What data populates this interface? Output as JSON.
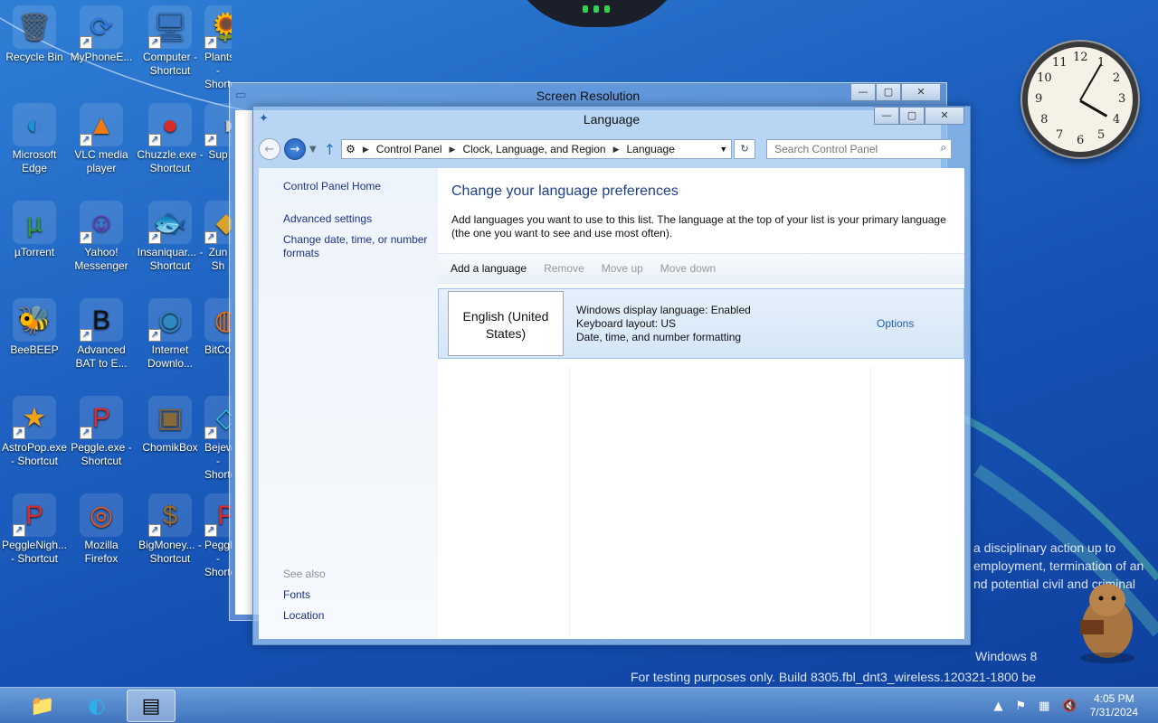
{
  "desktop": {
    "icons": [
      {
        "label": "Recycle Bin",
        "glyph": "🗑"
      },
      {
        "label": "MyPhoneE...",
        "glyph": "⟳"
      },
      {
        "label": "Computer - Shortcut",
        "glyph": "🖥"
      },
      {
        "label": "PlantsVsZo... - Shortcut",
        "glyph": "🌻"
      },
      {
        "label": "Microsoft Edge",
        "glyph": "◐"
      },
      {
        "label": "VLC media player",
        "glyph": "▲"
      },
      {
        "label": "Chuzzle.exe - Shortcut",
        "glyph": "●"
      },
      {
        "label": "Sup",
        "glyph": "◑"
      },
      {
        "label": "µTorrent",
        "glyph": "µ"
      },
      {
        "label": "Yahoo! Messenger",
        "glyph": "☺"
      },
      {
        "label": "Insaniquar... - Shortcut",
        "glyph": "🐟"
      },
      {
        "label": "Zun Sh",
        "glyph": "◆"
      },
      {
        "label": "BeeBEEP",
        "glyph": "🐝"
      },
      {
        "label": "Advanced BAT to E...",
        "glyph": "B"
      },
      {
        "label": "Internet Downlo...",
        "glyph": "◉"
      },
      {
        "label": "BitComet",
        "glyph": "◍"
      },
      {
        "label": "AstroPop.exe - Shortcut",
        "glyph": "★"
      },
      {
        "label": "Peggle.exe - Shortcut",
        "glyph": "P"
      },
      {
        "label": "ChomikBox",
        "glyph": "▣"
      },
      {
        "label": "Bejeweled... - Shortcut",
        "glyph": "◇"
      },
      {
        "label": "PeggleNigh... - Shortcut",
        "glyph": "P"
      },
      {
        "label": "Mozilla Firefox",
        "glyph": "◎"
      },
      {
        "label": "BigMoney... - Shortcut",
        "glyph": "$"
      },
      {
        "label": "PeggleWo... - Shortcut",
        "glyph": "P"
      }
    ],
    "watermark_line1": "a disciplinary action up to",
    "watermark_line2": "employment, termination of an",
    "watermark_line3": "nd potential civil and criminal",
    "watermark_windows": "Windows 8",
    "watermark_build": "For testing purposes only. Build 8305.fbl_dnt3_wireless.120321-1800 be",
    "clock_numbers": [
      "12",
      "1",
      "2",
      "3",
      "4",
      "5",
      "6",
      "7",
      "8",
      "9",
      "10",
      "11"
    ]
  },
  "back_window": {
    "title": "Screen Resolution"
  },
  "window": {
    "title": "Language",
    "caption": {
      "minimize": "—",
      "maximize": "▢",
      "close": "✕"
    },
    "breadcrumbs": [
      "Control Panel",
      "Clock, Language, and Region",
      "Language"
    ],
    "search_placeholder": "Search Control Panel",
    "left_links": {
      "home": "Control Panel Home",
      "advanced": "Advanced settings",
      "change_formats": "Change date, time, or number formats"
    },
    "see_also": {
      "heading": "See also",
      "fonts": "Fonts",
      "location": "Location"
    },
    "heading": "Change your language preferences",
    "description": "Add languages you want to use to this list. The language at the top of your list is your primary language (the one you want to see and use most often).",
    "toolbar": {
      "add": "Add a language",
      "remove": "Remove",
      "move_up": "Move up",
      "move_down": "Move down"
    },
    "language": {
      "name": "English (United States)",
      "display": "Windows display language: Enabled",
      "keyboard": "Keyboard layout: US",
      "formatting": "Date, time, and number formatting",
      "options": "Options"
    }
  },
  "taskbar": {
    "time": "4:05 PM",
    "date": "7/31/2024"
  }
}
